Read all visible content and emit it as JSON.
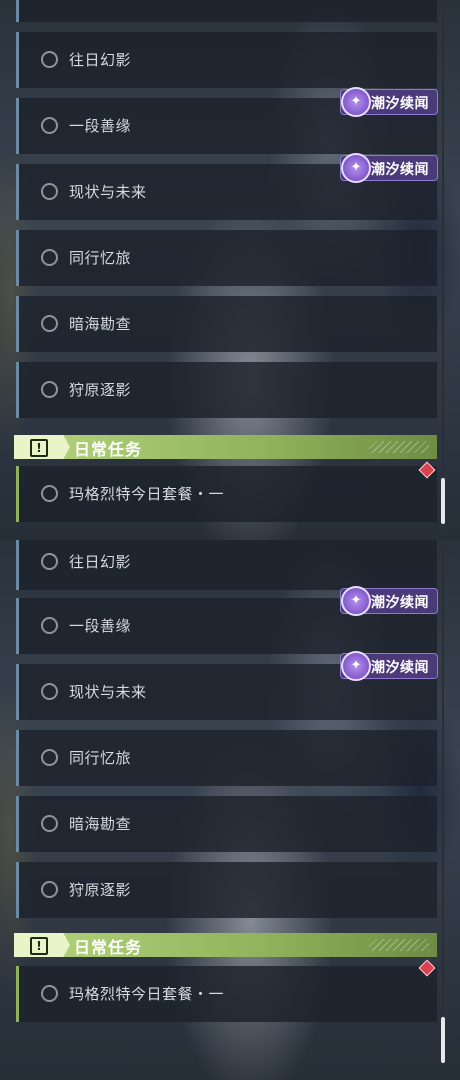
{
  "panels": [
    {
      "quests": [
        {
          "label": ""
        },
        {
          "label": "往日幻影"
        },
        {
          "label": "一段善缘"
        },
        {
          "label": "现状与未来"
        },
        {
          "label": "同行忆旅"
        },
        {
          "label": "暗海勘查"
        },
        {
          "label": "狩原逐影"
        }
      ],
      "badges": [
        "潮汐续闻",
        "潮汐续闻"
      ],
      "daily": {
        "title": "日常任务",
        "quest": "玛格烈特今日套餐・一"
      }
    },
    {
      "quests": [
        {
          "label": "往日幻影"
        },
        {
          "label": "一段善缘"
        },
        {
          "label": "现状与未来"
        },
        {
          "label": "同行忆旅"
        },
        {
          "label": "暗海勘查"
        },
        {
          "label": "狩原逐影"
        }
      ],
      "badges": [
        "潮汐续闻",
        "潮汐续闻"
      ],
      "daily": {
        "title": "日常任务",
        "quest": "玛格烈特今日套餐・一"
      }
    }
  ],
  "colors": {
    "accent_blue": "#6b8aa3",
    "daily_green": "#8fb35a",
    "badge_purple": "#4a3a7a",
    "marker_red": "#d94050"
  },
  "icons": {
    "quest_status": "circle-icon",
    "badge": "tide-event-icon",
    "daily": "alert-icon",
    "marker": "diamond-marker-icon"
  }
}
